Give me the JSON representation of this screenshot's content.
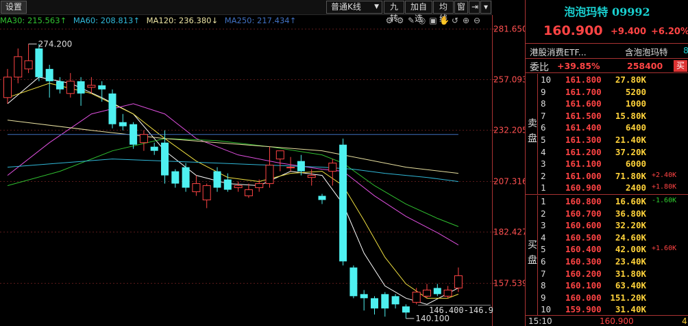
{
  "toolbar": {
    "settings_label": "设置",
    "period": "普通K线",
    "btn_jiuzhuan": "九转",
    "btn_add_watch": "加自选",
    "btn_junxian": "均线",
    "btn_window": "窗"
  },
  "ma_legend": {
    "ma30": "MA30: 215.563↑",
    "ma60": "MA60: 208.813↑",
    "ma120": "MA120: 236.380↓",
    "ma250": "MA250: 217.434↑"
  },
  "chart_icons": [
    "settings-gear-icon",
    "settings-gear-alt-icon",
    "draw-pen-icon",
    "eye-off-icon",
    "bag-icon",
    "hand-pan-icon",
    "restore-icon",
    "zoom-in-icon",
    "zoom-out-icon"
  ],
  "chart_data": {
    "type": "candlestick",
    "y_ticks": [
      281.65,
      257.093,
      232.205,
      207.316,
      182.427,
      157.539
    ],
    "ylim": [
      140.1,
      281.65
    ],
    "candles": [
      {
        "o": 248,
        "h": 262,
        "l": 245,
        "c": 258
      },
      {
        "o": 258,
        "h": 272,
        "l": 255,
        "c": 268
      },
      {
        "o": 262,
        "h": 274.2,
        "l": 260,
        "c": 266
      },
      {
        "o": 272,
        "h": 274.2,
        "l": 256,
        "c": 258
      },
      {
        "o": 262,
        "h": 264,
        "l": 248,
        "c": 256
      },
      {
        "o": 256,
        "h": 258,
        "l": 250,
        "c": 252
      },
      {
        "o": 250,
        "h": 260,
        "l": 248,
        "c": 256
      },
      {
        "o": 256,
        "h": 258,
        "l": 244,
        "c": 250
      },
      {
        "o": 253,
        "h": 258,
        "l": 250,
        "c": 254
      },
      {
        "o": 254,
        "h": 256,
        "l": 246,
        "c": 252
      },
      {
        "o": 250,
        "h": 252,
        "l": 233,
        "c": 235
      },
      {
        "o": 236,
        "h": 240,
        "l": 232,
        "c": 234
      },
      {
        "o": 235,
        "h": 236,
        "l": 223,
        "c": 225
      },
      {
        "o": 226,
        "h": 232,
        "l": 222,
        "c": 230
      },
      {
        "o": 224,
        "h": 226,
        "l": 220,
        "c": 222
      },
      {
        "o": 226,
        "h": 232,
        "l": 206,
        "c": 210
      },
      {
        "o": 212,
        "h": 213,
        "l": 204,
        "c": 206
      },
      {
        "o": 214,
        "h": 216,
        "l": 202,
        "c": 204
      },
      {
        "o": 202,
        "h": 210,
        "l": 200,
        "c": 206
      },
      {
        "o": 198,
        "h": 206,
        "l": 194,
        "c": 205
      },
      {
        "o": 212,
        "h": 214,
        "l": 202,
        "c": 204
      },
      {
        "o": 208,
        "h": 211,
        "l": 202,
        "c": 203
      },
      {
        "o": 204,
        "h": 207,
        "l": 202,
        "c": 205
      },
      {
        "o": 200,
        "h": 206,
        "l": 199,
        "c": 203
      },
      {
        "o": 204,
        "h": 208,
        "l": 202,
        "c": 206
      },
      {
        "o": 206,
        "h": 224,
        "l": 204,
        "c": 215
      },
      {
        "o": 218,
        "h": 222,
        "l": 212,
        "c": 222
      },
      {
        "o": 214,
        "h": 219,
        "l": 212,
        "c": 214
      },
      {
        "o": 217,
        "h": 220,
        "l": 210,
        "c": 212
      },
      {
        "o": 209,
        "h": 213,
        "l": 205,
        "c": 210
      },
      {
        "o": 200,
        "h": 201,
        "l": 196,
        "c": 198
      },
      {
        "o": 212,
        "h": 218,
        "l": 205,
        "c": 216
      },
      {
        "o": 225,
        "h": 228,
        "l": 166,
        "c": 168
      },
      {
        "o": 165,
        "h": 166,
        "l": 150,
        "c": 151
      },
      {
        "o": 152,
        "h": 154,
        "l": 144,
        "c": 150
      },
      {
        "o": 150,
        "h": 151,
        "l": 142,
        "c": 145
      },
      {
        "o": 152,
        "h": 153,
        "l": 141,
        "c": 145
      },
      {
        "o": 151,
        "h": 152,
        "l": 145,
        "c": 147
      },
      {
        "o": 146,
        "h": 147,
        "l": 140.1,
        "c": 143
      },
      {
        "o": 148,
        "h": 155,
        "l": 147,
        "c": 153
      },
      {
        "o": 151,
        "h": 157,
        "l": 150,
        "c": 154
      },
      {
        "o": 155,
        "h": 157,
        "l": 151,
        "c": 152
      },
      {
        "o": 151,
        "h": 156,
        "l": 150,
        "c": 154
      },
      {
        "o": 155,
        "h": 165,
        "l": 153,
        "c": 161
      }
    ],
    "ma_lines": [
      {
        "name": "MA5",
        "color": "#ffffff",
        "points": [
          [
            0,
            245
          ],
          [
            3,
            258
          ],
          [
            6,
            255
          ],
          [
            9,
            248
          ],
          [
            12,
            240
          ],
          [
            15,
            222
          ],
          [
            18,
            210
          ],
          [
            21,
            206
          ],
          [
            24,
            205
          ],
          [
            27,
            212
          ],
          [
            30,
            210
          ],
          [
            32,
            196
          ],
          [
            34,
            172
          ],
          [
            36,
            156
          ],
          [
            38,
            150
          ],
          [
            40,
            147
          ],
          [
            43,
            155
          ]
        ]
      },
      {
        "name": "MA10",
        "color": "#f0e040",
        "points": [
          [
            0,
            248
          ],
          [
            4,
            255
          ],
          [
            8,
            250
          ],
          [
            12,
            240
          ],
          [
            15,
            228
          ],
          [
            18,
            217
          ],
          [
            21,
            209
          ],
          [
            24,
            207
          ],
          [
            27,
            211
          ],
          [
            30,
            212
          ],
          [
            32,
            205
          ],
          [
            34,
            188
          ],
          [
            36,
            170
          ],
          [
            38,
            157
          ],
          [
            40,
            150
          ],
          [
            42,
            150
          ],
          [
            43,
            152
          ]
        ]
      },
      {
        "name": "MA20",
        "color": "#e050e0",
        "points": [
          [
            0,
            210
          ],
          [
            4,
            226
          ],
          [
            8,
            240
          ],
          [
            12,
            245
          ],
          [
            15,
            240
          ],
          [
            18,
            228
          ],
          [
            22,
            220
          ],
          [
            26,
            216
          ],
          [
            30,
            213
          ],
          [
            32,
            212
          ],
          [
            35,
            200
          ],
          [
            38,
            190
          ],
          [
            41,
            182
          ],
          [
            43,
            176
          ]
        ]
      },
      {
        "name": "MA30",
        "color": "#30c030",
        "points": [
          [
            0,
            205
          ],
          [
            5,
            212
          ],
          [
            10,
            222
          ],
          [
            15,
            228
          ],
          [
            20,
            227
          ],
          [
            25,
            224
          ],
          [
            30,
            220
          ],
          [
            32,
            216
          ],
          [
            35,
            205
          ],
          [
            38,
            196
          ],
          [
            41,
            189
          ],
          [
            43,
            185
          ]
        ]
      },
      {
        "name": "MA60",
        "color": "#30b8d8",
        "points": [
          [
            0,
            214
          ],
          [
            5,
            216
          ],
          [
            10,
            218
          ],
          [
            15,
            217
          ],
          [
            20,
            216
          ],
          [
            25,
            215
          ],
          [
            30,
            214
          ],
          [
            33,
            213
          ],
          [
            36,
            211
          ],
          [
            40,
            209
          ],
          [
            43,
            207
          ]
        ]
      },
      {
        "name": "MA120",
        "color": "#e8e0a0",
        "points": [
          [
            0,
            237
          ],
          [
            8,
            232
          ],
          [
            15,
            228
          ],
          [
            20,
            226
          ],
          [
            25,
            224
          ],
          [
            30,
            222
          ],
          [
            34,
            218
          ],
          [
            38,
            214
          ],
          [
            43,
            211
          ]
        ]
      },
      {
        "name": "MA250",
        "color": "#4070c0",
        "points": [
          [
            0,
            230
          ],
          [
            10,
            230
          ],
          [
            20,
            230
          ],
          [
            30,
            230
          ],
          [
            43,
            230
          ]
        ]
      }
    ],
    "annotations": {
      "high_label": "274.200",
      "low_label": "140.100",
      "range_label": "146.400-146.9"
    }
  },
  "quote": {
    "title": "泡泡玛特 09992",
    "last_price": "160.900",
    "change": "+9.400",
    "change_pct": "+6.20%",
    "related_etf": "港股消费ETF...",
    "related_name": "含泡泡玛特",
    "related_num": "8",
    "weibi_label": "委比",
    "weibi_pct": "+39.85%",
    "weibi_diff": "258400",
    "weibi_btn": "买",
    "ask_label": "卖盘",
    "bid_label": "买盘",
    "asks": [
      {
        "n": "10",
        "p": "161.800",
        "v": "27.80K",
        "c": ""
      },
      {
        "n": "9",
        "p": "161.700",
        "v": "5200",
        "c": ""
      },
      {
        "n": "8",
        "p": "161.600",
        "v": "1000",
        "c": ""
      },
      {
        "n": "7",
        "p": "161.500",
        "v": "15.80K",
        "c": ""
      },
      {
        "n": "6",
        "p": "161.400",
        "v": "6400",
        "c": ""
      },
      {
        "n": "5",
        "p": "161.300",
        "v": "21.40K",
        "c": ""
      },
      {
        "n": "4",
        "p": "161.200",
        "v": "37.20K",
        "c": ""
      },
      {
        "n": "3",
        "p": "161.100",
        "v": "6000",
        "c": ""
      },
      {
        "n": "2",
        "p": "161.000",
        "v": "71.80K",
        "c": "+2.40K"
      },
      {
        "n": "1",
        "p": "160.900",
        "v": "2400",
        "c": "+1.80K"
      }
    ],
    "bids": [
      {
        "n": "1",
        "p": "160.800",
        "v": "16.60K",
        "c": "-1.60K"
      },
      {
        "n": "2",
        "p": "160.700",
        "v": "36.80K",
        "c": ""
      },
      {
        "n": "3",
        "p": "160.600",
        "v": "32.20K",
        "c": ""
      },
      {
        "n": "4",
        "p": "160.500",
        "v": "24.60K",
        "c": ""
      },
      {
        "n": "5",
        "p": "160.400",
        "v": "42.00K",
        "c": "+1.60K"
      },
      {
        "n": "6",
        "p": "160.300",
        "v": "23.40K",
        "c": ""
      },
      {
        "n": "7",
        "p": "160.200",
        "v": "31.80K",
        "c": ""
      },
      {
        "n": "8",
        "p": "160.100",
        "v": "63.40K",
        "c": ""
      },
      {
        "n": "9",
        "p": "160.000",
        "v": "151.20K",
        "c": ""
      },
      {
        "n": "10",
        "p": "159.900",
        "v": "31.40K",
        "c": ""
      }
    ],
    "footer_time": "15:10",
    "footer_price": "160.900",
    "footer_vol": "4"
  },
  "colors": {
    "up": "#ff4444",
    "down": "#4ef0f0",
    "grid": "#5a1a1a",
    "axis": "#a33"
  }
}
